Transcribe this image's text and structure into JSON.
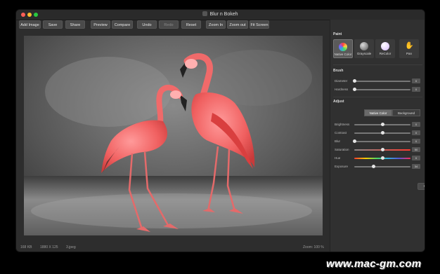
{
  "window": {
    "title": "Blur n Bokeh"
  },
  "toolbar": {
    "add_image": "Add Image",
    "save": "Save",
    "share": "Share",
    "preview": "Preview",
    "compare": "Compare",
    "undo": "Undo",
    "redo": "Redo",
    "reset": "Reset",
    "zoom_in": "Zoom In",
    "zoom_out": "Zoom out",
    "fit_screen": "Fit Screen"
  },
  "status": {
    "size": "168 KB",
    "dimensions": "1880 X 125",
    "file": "3.jpeg",
    "zoom": "Zoom: 100 %"
  },
  "panel": {
    "paint_title": "Paint",
    "modes": [
      {
        "label": "Native Color",
        "icon": "color-wheel-icon",
        "selected": true
      },
      {
        "label": "Grayscale",
        "icon": "grayscale-ball-icon",
        "selected": false
      },
      {
        "label": "ReColor",
        "icon": "recolor-ball-icon",
        "selected": false
      },
      {
        "label": "Pan",
        "icon": "hand-icon",
        "selected": false
      }
    ],
    "brush_title": "Brush",
    "brush": [
      {
        "label": "Diameter",
        "value": "0",
        "level": 0.0
      },
      {
        "label": "Hardness",
        "value": "0",
        "level": 0.0
      }
    ],
    "adjust_title": "Adjust",
    "adjust_tabs": [
      {
        "label": "Native Color",
        "selected": true
      },
      {
        "label": "Background",
        "selected": false
      }
    ],
    "adjust": [
      {
        "label": "Brightness",
        "value": "0",
        "level": 0.5
      },
      {
        "label": "Contrast",
        "value": "0",
        "level": 0.5
      },
      {
        "label": "Blur",
        "value": "0",
        "level": 0.0
      },
      {
        "label": "Saturation",
        "value": "50",
        "level": 0.5
      },
      {
        "label": "Hue",
        "value": "0",
        "level": 0.5
      },
      {
        "label": "Exposure",
        "value": "34",
        "level": 0.34
      }
    ],
    "reset": "Reset"
  },
  "watermark": "www.mac-gm.com",
  "colors": {
    "flamingo": "#f26a6a",
    "accent_red": "#ff5f57",
    "panel_bg": "#303030"
  }
}
